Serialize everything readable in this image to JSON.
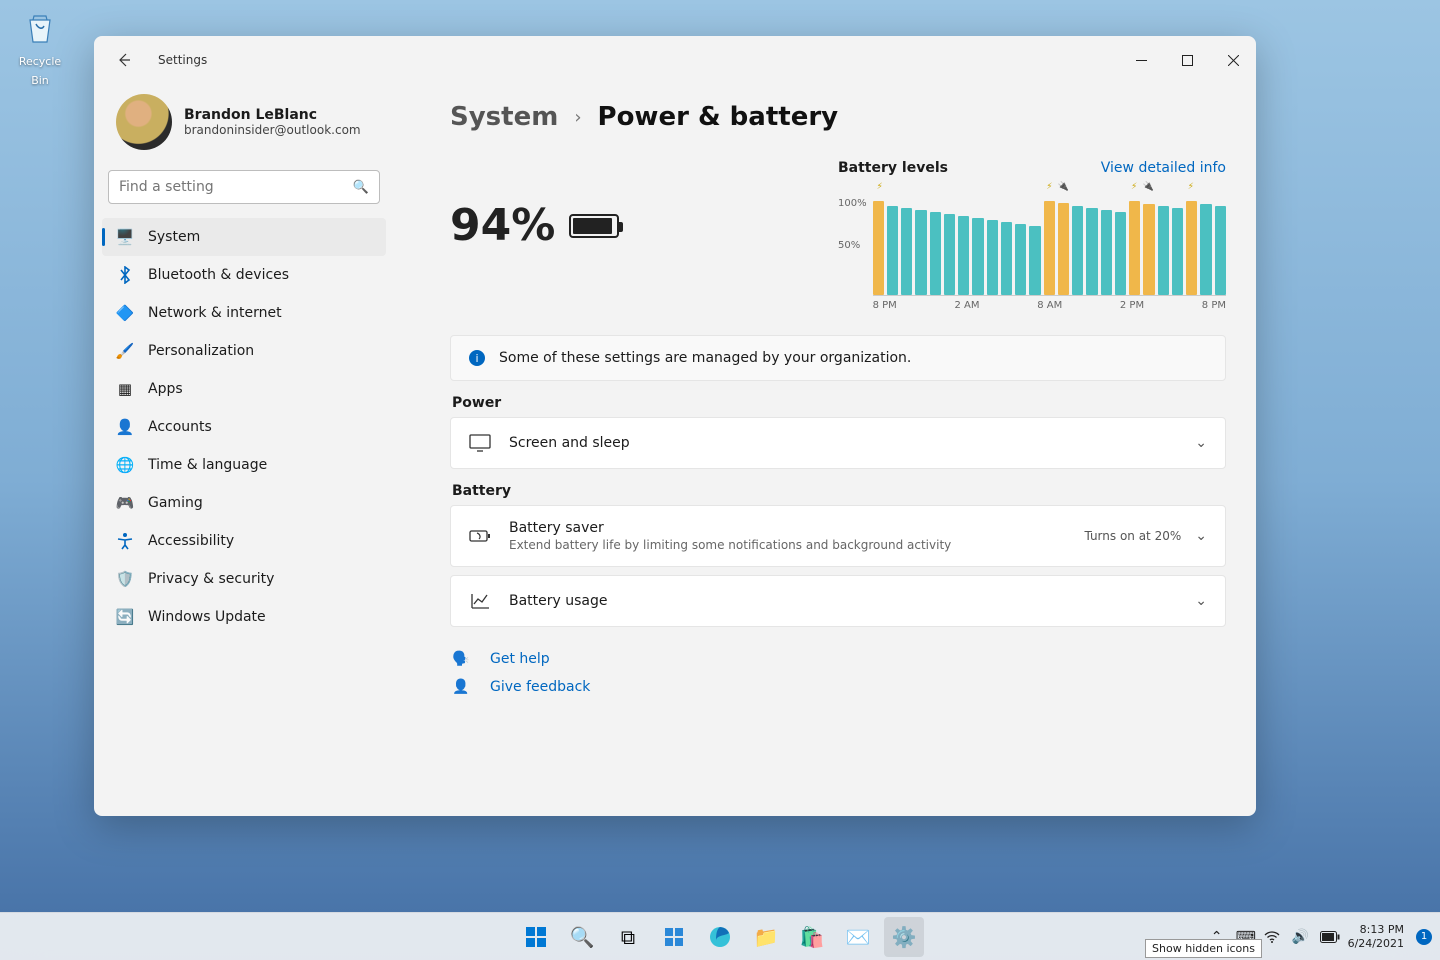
{
  "desktop": {
    "recycle_bin_label": "Recycle Bin"
  },
  "window": {
    "title": "Settings",
    "user_name": "Brandon LeBlanc",
    "user_email": "brandoninsider@outlook.com",
    "search_placeholder": "Find a setting"
  },
  "sidebar": {
    "items": [
      {
        "label": "System",
        "icon": "🖥️",
        "active": true
      },
      {
        "label": "Bluetooth & devices",
        "icon": "bt"
      },
      {
        "label": "Network & internet",
        "icon": "🔷"
      },
      {
        "label": "Personalization",
        "icon": "🖌️"
      },
      {
        "label": "Apps",
        "icon": "▦"
      },
      {
        "label": "Accounts",
        "icon": "👤"
      },
      {
        "label": "Time & language",
        "icon": "🌐"
      },
      {
        "label": "Gaming",
        "icon": "🎮"
      },
      {
        "label": "Accessibility",
        "icon": "acc"
      },
      {
        "label": "Privacy & security",
        "icon": "🛡️"
      },
      {
        "label": "Windows Update",
        "icon": "🔄"
      }
    ]
  },
  "breadcrumb": {
    "parent": "System",
    "current": "Power & battery"
  },
  "battery_pct": "94%",
  "chart_title": "Battery levels",
  "chart_link": "View detailed info",
  "chart_data": {
    "type": "bar",
    "title": "Battery levels",
    "ylabel": "%",
    "ylim": [
      0,
      100
    ],
    "yticks": [
      "100%",
      "50%"
    ],
    "xticks": [
      "8 PM",
      "2 AM",
      "8 AM",
      "2 PM",
      "8 PM"
    ],
    "categories": [
      "8PM",
      "9PM",
      "10PM",
      "11PM",
      "12AM",
      "1AM",
      "2AM",
      "3AM",
      "4AM",
      "5AM",
      "6AM",
      "7AM",
      "8AM",
      "9AM",
      "10AM",
      "11AM",
      "12PM",
      "1PM",
      "2PM",
      "3PM",
      "4PM",
      "5PM",
      "6PM",
      "7PM",
      "8PM"
    ],
    "series": [
      {
        "name": "level",
        "values": [
          95,
          90,
          88,
          86,
          84,
          82,
          80,
          78,
          76,
          74,
          72,
          70,
          95,
          93,
          90,
          88,
          86,
          84,
          95,
          92,
          90,
          88,
          95,
          92,
          90
        ]
      },
      {
        "name": "charging",
        "values": [
          true,
          false,
          false,
          false,
          false,
          false,
          false,
          false,
          false,
          false,
          false,
          false,
          true,
          true,
          false,
          false,
          false,
          false,
          true,
          true,
          false,
          false,
          true,
          false,
          false
        ]
      }
    ]
  },
  "info_text": "Some of these settings are managed by your organization.",
  "section_power": "Power",
  "section_battery": "Battery",
  "card_screen_sleep": "Screen and sleep",
  "card_saver_title": "Battery saver",
  "card_saver_desc": "Extend battery life by limiting some notifications and background activity",
  "card_saver_meta": "Turns on at 20%",
  "card_usage": "Battery usage",
  "help_get": "Get help",
  "help_feedback": "Give feedback",
  "taskbar": {
    "tooltip": "Show hidden icons",
    "time": "8:13 PM",
    "date": "6/24/2021",
    "badge": "1"
  }
}
